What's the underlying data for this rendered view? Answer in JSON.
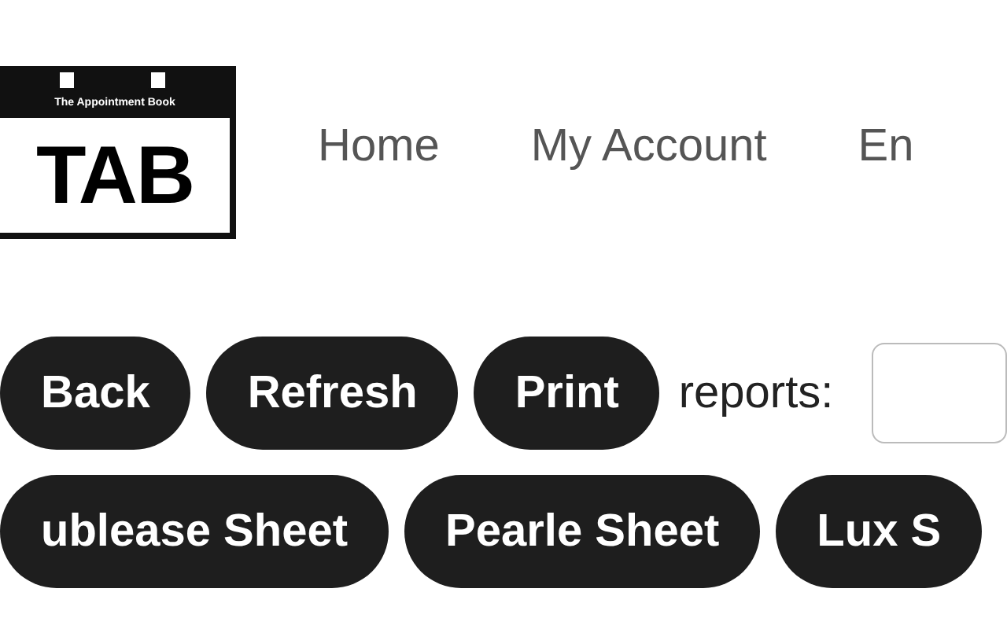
{
  "logo": {
    "tagline": "The Appointment Book",
    "wordmark": "TAB"
  },
  "nav": [
    {
      "label": "Home"
    },
    {
      "label": "My Account"
    },
    {
      "label": "En"
    }
  ],
  "toolbar": {
    "buttons": [
      "Back",
      "Refresh",
      "Print"
    ],
    "reports_label": "reports:"
  },
  "report_buttons": [
    "ublease Sheet",
    "Pearle Sheet",
    "Lux S"
  ]
}
